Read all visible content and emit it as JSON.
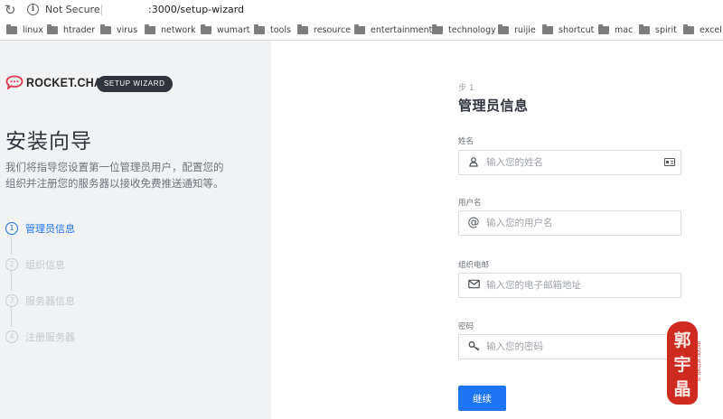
{
  "browser": {
    "security_label": "Not Secure",
    "url_visible": ":3000/setup-wizard",
    "bookmarks": [
      "linux",
      "htrader",
      "virus",
      "network",
      "wumart",
      "tools",
      "resource",
      "entertainment",
      "technology",
      "ruijie",
      "shortcut",
      "mac",
      "spirit",
      "excel"
    ]
  },
  "brand": {
    "logo_text": "ROCKET.CHAT",
    "badge": "SETUP WIZARD",
    "logo_color": "#e0364d"
  },
  "sidebar": {
    "title": "安装向导",
    "description": "我们将指导您设置第一位管理员用户，配置您的组织并注册您的服务器以接收免费推送通知等。",
    "steps": [
      {
        "number": "1",
        "label": "管理员信息",
        "active": true
      },
      {
        "number": "2",
        "label": "组织信息",
        "active": false
      },
      {
        "number": "3",
        "label": "服务器信息",
        "active": false
      },
      {
        "number": "4",
        "label": "注册服务器",
        "active": false
      }
    ]
  },
  "form": {
    "step_tag": "步 1",
    "title": "管理员信息",
    "fields": [
      {
        "label": "姓名",
        "placeholder": "输入您的姓名",
        "icon": "user-icon"
      },
      {
        "label": "用户名",
        "placeholder": "输入您的用户名",
        "icon": "at-icon"
      },
      {
        "label": "组织电邮",
        "placeholder": "输入您的电子邮箱地址",
        "icon": "mail-icon"
      },
      {
        "label": "密码",
        "placeholder": "输入您的密码",
        "icon": "key-icon"
      }
    ],
    "continue_label": "继续"
  },
  "colors": {
    "accent": "#1d74f5",
    "sidebar_bg": "#f1f2f4",
    "badge_bg": "#2f343d",
    "seal": "#cf2a1f"
  },
  "seal": {
    "chars": [
      "郭",
      "宇",
      "晶"
    ],
    "side_text": "gyrvgr.github.io"
  }
}
